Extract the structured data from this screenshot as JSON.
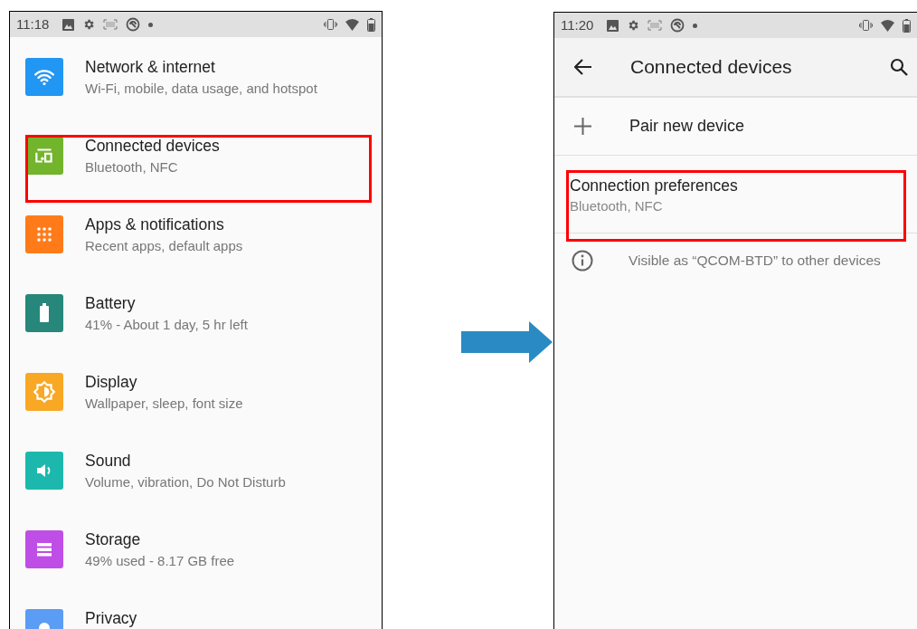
{
  "left_screen": {
    "status_bar": {
      "time": "11:18"
    },
    "items": [
      {
        "title": "Network & internet",
        "subtitle": "Wi-Fi, mobile, data usage, and hotspot",
        "color": "#2196f3",
        "highlighted": false
      },
      {
        "title": "Connected devices",
        "subtitle": "Bluetooth, NFC",
        "color": "#72b42b",
        "highlighted": true
      },
      {
        "title": "Apps & notifications",
        "subtitle": "Recent apps, default apps",
        "color": "#ff7b1a",
        "highlighted": false
      },
      {
        "title": "Battery",
        "subtitle": "41% - About 1 day, 5 hr left",
        "color": "#26877a",
        "highlighted": false
      },
      {
        "title": "Display",
        "subtitle": "Wallpaper, sleep, font size",
        "color": "#f9a825",
        "highlighted": false
      },
      {
        "title": "Sound",
        "subtitle": "Volume, vibration, Do Not Disturb",
        "color": "#1db8ad",
        "highlighted": false
      },
      {
        "title": "Storage",
        "subtitle": "49% used - 8.17 GB free",
        "color": "#bf4ee6",
        "highlighted": false
      },
      {
        "title": "Privacy",
        "color": "#5b9cf5",
        "highlighted": false
      }
    ]
  },
  "right_screen": {
    "status_bar": {
      "time": "11:20"
    },
    "toolbar": {
      "title": "Connected devices"
    },
    "rows": [
      {
        "kind": "action",
        "title": "Pair new device",
        "highlighted": false
      },
      {
        "kind": "preference",
        "title": "Connection preferences",
        "subtitle": "Bluetooth, NFC",
        "highlighted": true
      },
      {
        "kind": "info",
        "title": "Visible as “QCOM-BTD” to other devices",
        "highlighted": false
      }
    ]
  }
}
